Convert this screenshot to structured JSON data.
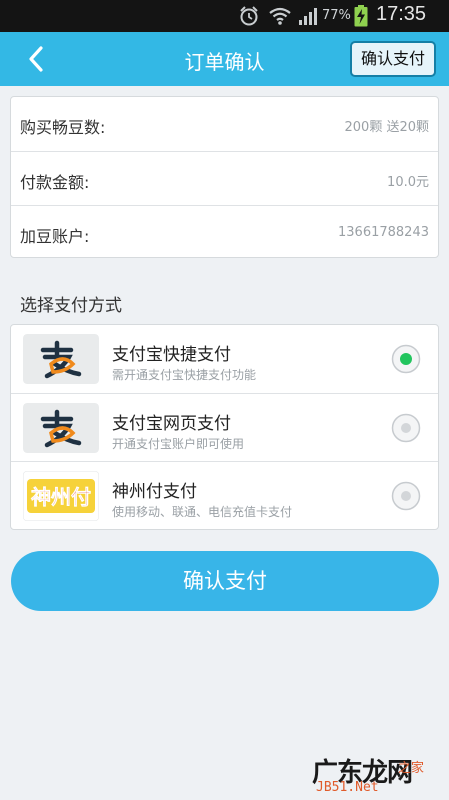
{
  "status_bar": {
    "battery_percent": "77%",
    "time": "17:35",
    "icons": [
      "alarm-icon",
      "wifi-icon",
      "signal-icon",
      "battery-charging-icon"
    ]
  },
  "nav": {
    "title": "订单确认",
    "back_icon": "chevron-left-icon",
    "confirm_label": "确认支付"
  },
  "order_info": {
    "rows": [
      {
        "label": "购买畅豆数:",
        "value": "200颗 送20颗"
      },
      {
        "label": "付款金额:",
        "value": "10.0元"
      },
      {
        "label": "加豆账户:",
        "value": "13661788243"
      }
    ]
  },
  "payment": {
    "section_title": "选择支付方式",
    "methods": [
      {
        "name": "支付宝快捷支付",
        "desc": "需开通支付宝快捷支付功能",
        "logo": "alipay-logo",
        "selected": true
      },
      {
        "name": "支付宝网页支付",
        "desc": "开通支付宝账户即可使用",
        "logo": "alipay-logo",
        "selected": false
      },
      {
        "name": "神州付支付",
        "desc": "使用移动、联通、电信充值卡支付",
        "logo": "shenzhoufu-logo",
        "logo_text": "神州付",
        "selected": false
      }
    ]
  },
  "confirm_button": {
    "label": "确认支付"
  },
  "watermark": {
    "brand": "广东龙网",
    "site": "JB51.Net",
    "home": "之家"
  },
  "colors": {
    "nav_bg": "#33b8e5",
    "button_bg": "#38b5e8",
    "radio_selected": "#22c55e",
    "page_bg": "#eef1f4"
  }
}
